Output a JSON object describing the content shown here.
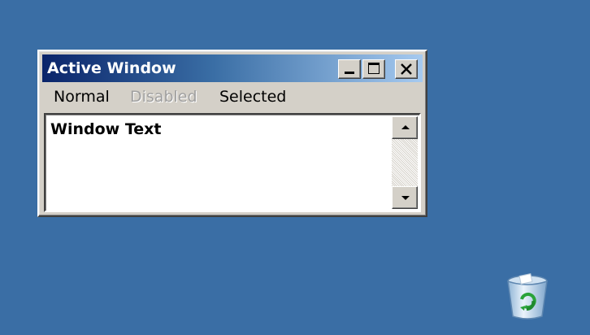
{
  "desktop": {
    "background_color": "#3a6ea5"
  },
  "window": {
    "title": "Active Window",
    "titlebar_colors": [
      "#0a246a",
      "#a6caf0"
    ],
    "controls": {
      "minimize_icon": "minimize-icon",
      "maximize_icon": "maximize-icon",
      "close_icon": "close-icon"
    },
    "menu": {
      "items": [
        {
          "label": "Normal",
          "state": "normal"
        },
        {
          "label": "Disabled",
          "state": "disabled"
        },
        {
          "label": "Selected",
          "state": "selected"
        }
      ]
    },
    "content": {
      "text": "Window Text"
    },
    "scrollbar": {
      "up_icon": "arrow-up-icon",
      "down_icon": "arrow-down-icon"
    }
  },
  "desktop_icons": [
    {
      "icon": "recycle-bin-icon"
    }
  ]
}
